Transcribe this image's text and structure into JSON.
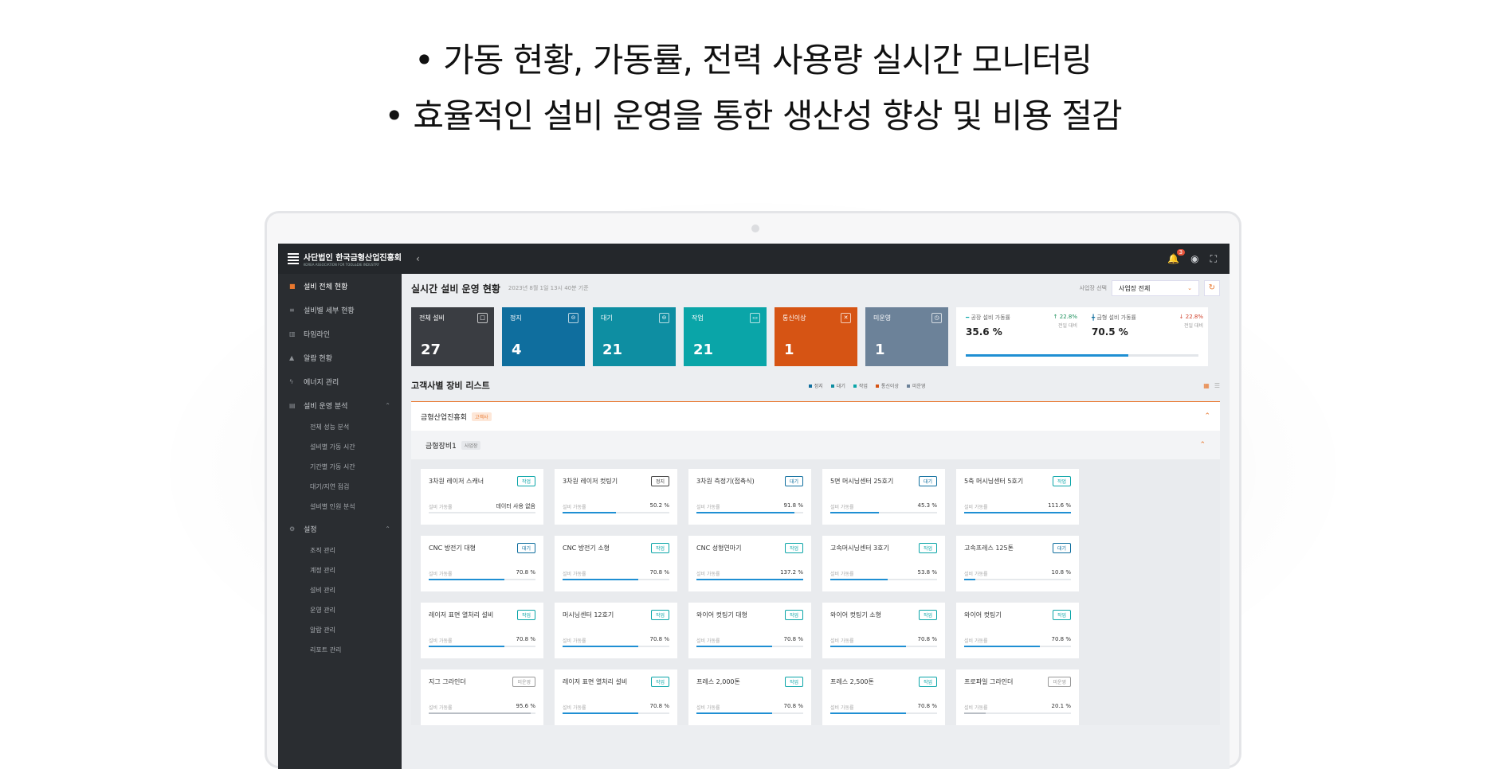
{
  "headlines": [
    "• 가동 현황, 가동률, 전력 사용량 실시간 모니터링",
    "• 효율적인 설비 운영을 통한 생산성 향상 및 비용 절감"
  ],
  "app": {
    "org_name": "사단법인 한국금형산업진흥회",
    "org_sub": "KOREA ASSOCIATION FOR TOOL&DIE INDUSTRY",
    "notification_count": "3"
  },
  "sidebar": {
    "items": [
      {
        "label": "설비 전체 현황",
        "icon": "grid-icon",
        "active": true
      },
      {
        "label": "설비별 세부 현황",
        "icon": "list-icon"
      },
      {
        "label": "타임라인",
        "icon": "bar-icon"
      },
      {
        "label": "알람 현황",
        "icon": "bell-icon"
      },
      {
        "label": "에너지 관리",
        "icon": "bolt-icon"
      },
      {
        "label": "설비 운영 분석",
        "icon": "doc-icon",
        "expanded": true
      }
    ],
    "analysis_sub": [
      "전체 성능 분석",
      "설비별 가동 시간",
      "기간별 가동 시간",
      "대기/지연 점검",
      "설비별 인원 분석"
    ],
    "settings": {
      "label": "설정",
      "icon": "gear-icon"
    },
    "settings_sub": [
      "조직 관리",
      "계정 관리",
      "설비 관리",
      "운영 관리",
      "알람 관리",
      "리포트 관리"
    ]
  },
  "main": {
    "title": "실시간 설비 운영 현황",
    "date": "2023년 8월 1일 13시 40분 기준",
    "site_label": "사업장 선택",
    "site_value": "사업장 전체"
  },
  "status_cards": [
    {
      "label": "전체 설비",
      "value": "27",
      "color": "#3a3d42",
      "icon": "□"
    },
    {
      "label": "정지",
      "value": "4",
      "color": "#0f6e9e",
      "icon": "⊝"
    },
    {
      "label": "대기",
      "value": "21",
      "color": "#0e8ea2",
      "icon": "⊖"
    },
    {
      "label": "작업",
      "value": "21",
      "color": "#0aa5a8",
      "icon": "▭"
    },
    {
      "label": "통신이상",
      "value": "1",
      "color": "#d65414",
      "icon": "✕"
    },
    {
      "label": "미운영",
      "value": "1",
      "color": "#6c8299",
      "icon": "◷"
    }
  ],
  "rates": {
    "plant": {
      "label": "공장 설비 가동률",
      "value": "35.6 %",
      "change": "↑ 22.8%",
      "change_sub": "전일 대비",
      "change_color": "#1a8f5a"
    },
    "metal": {
      "label": "금형 설비 가동률",
      "value": "70.5 %",
      "change": "↓ 22.8%",
      "change_sub": "전일 대비",
      "change_color": "#d0402b"
    },
    "progress": 0.7
  },
  "list": {
    "title": "고객사별 장비 리스트",
    "legend": [
      {
        "label": "정지",
        "color": "#0f6e9e"
      },
      {
        "label": "대기",
        "color": "#0e8ea2"
      },
      {
        "label": "작업",
        "color": "#0aa5a8"
      },
      {
        "label": "통신이상",
        "color": "#d65414"
      },
      {
        "label": "미운영",
        "color": "#6c8299"
      }
    ],
    "group_name": "금형산업진흥회",
    "group_tag": "고객사",
    "subgroup_name": "금형장비1",
    "subgroup_tag": "사업장",
    "rate_label": "설비 가동률"
  },
  "equipment": [
    {
      "name": "3차원 레이저 스캐너",
      "status": "작업",
      "rate": "데이터 사용 없음",
      "fill": 0
    },
    {
      "name": "3차원 레이저 컷팅기",
      "status": "정지",
      "rate": "50.2 %",
      "fill": 0.502
    },
    {
      "name": "3차원 측정기(접촉식)",
      "status": "대기",
      "rate": "91.8 %",
      "fill": 0.918
    },
    {
      "name": "5면 머시닝센터 25호기",
      "status": "대기",
      "rate": "45.3 %",
      "fill": 0.453
    },
    {
      "name": "5축 머시닝센터 5호기",
      "status": "작업",
      "rate": "111.6 %",
      "fill": 1
    },
    {
      "name": "CNC 방전기 대형",
      "status": "대기",
      "rate": "70.8 %",
      "fill": 0.708
    },
    {
      "name": "CNC 방전기 소형",
      "status": "작업",
      "rate": "70.8 %",
      "fill": 0.708
    },
    {
      "name": "CNC 성형연마기",
      "status": "작업",
      "rate": "137.2 %",
      "fill": 1
    },
    {
      "name": "고속머시닝센터 3호기",
      "status": "작업",
      "rate": "53.8 %",
      "fill": 0.538
    },
    {
      "name": "고속프레스 125톤",
      "status": "대기",
      "rate": "10.8 %",
      "fill": 0.108
    },
    {
      "name": "레이저 표면 열처리 설비",
      "status": "작업",
      "rate": "70.8 %",
      "fill": 0.708
    },
    {
      "name": "머시닝센터 12호기",
      "status": "작업",
      "rate": "70.8 %",
      "fill": 0.708
    },
    {
      "name": "와이어 컷팅기 대형",
      "status": "작업",
      "rate": "70.8 %",
      "fill": 0.708
    },
    {
      "name": "와이어 컷팅기 소형",
      "status": "작업",
      "rate": "70.8 %",
      "fill": 0.708
    },
    {
      "name": "와이어 컷팅기",
      "status": "작업",
      "rate": "70.8 %",
      "fill": 0.708
    },
    {
      "name": "지그 그라인더",
      "status": "미운영",
      "rate": "95.6 %",
      "fill": 0.956
    },
    {
      "name": "레이저 표면 열처리 설비",
      "status": "작업",
      "rate": "70.8 %",
      "fill": 0.708
    },
    {
      "name": "프레스 2,000톤",
      "status": "작업",
      "rate": "70.8 %",
      "fill": 0.708
    },
    {
      "name": "프레스 2,500톤",
      "status": "작업",
      "rate": "70.8 %",
      "fill": 0.708
    },
    {
      "name": "프로파일 그라인더",
      "status": "미운영",
      "rate": "20.1 %",
      "fill": 0.201
    }
  ],
  "status_colors": {
    "작업": "#0aa5a8",
    "정지": "#444",
    "대기": "#0f6e9e",
    "미운영": "#999",
    "통신이상": "#d65414"
  }
}
